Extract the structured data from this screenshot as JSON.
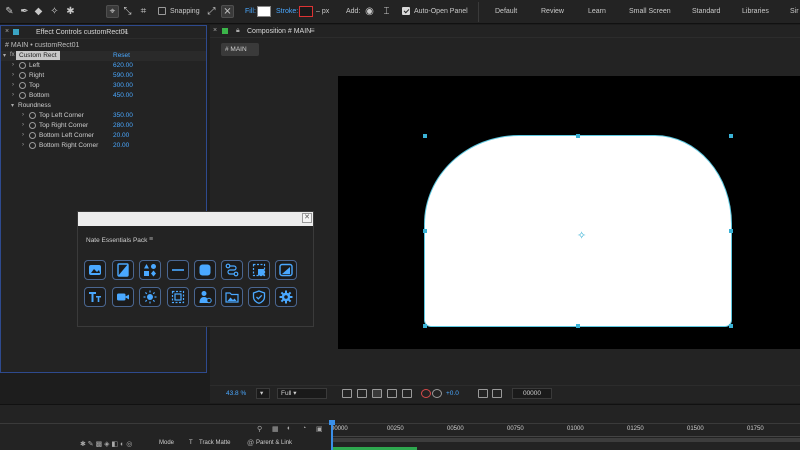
{
  "toolbar": {
    "snapping_label": "Snapping",
    "fill_label": "Fill:",
    "stroke_label": "Stroke:",
    "stroke_unit": "– px",
    "add_label": "Add:",
    "auto_open_label": "Auto-Open Panel",
    "workspaces": [
      "Default",
      "Review",
      "Learn",
      "Small Screen",
      "Standard",
      "Libraries",
      "Sir"
    ]
  },
  "effect_controls": {
    "tab_title": "Effect Controls customRect01",
    "subtitle": "# MAIN • customRect01",
    "effect_name": "Custom Rect",
    "reset_label": "Reset",
    "properties": [
      {
        "name": "Left",
        "value": "620.00"
      },
      {
        "name": "Right",
        "value": "590.00"
      },
      {
        "name": "Top",
        "value": "300.00"
      },
      {
        "name": "Bottom",
        "value": "450.00"
      }
    ],
    "group_name": "Roundness",
    "roundness": [
      {
        "name": "Top Left Corner",
        "value": "350.00"
      },
      {
        "name": "Top Right Corner",
        "value": "280.00"
      },
      {
        "name": "Bottom Left Corner",
        "value": "20.00"
      },
      {
        "name": "Bottom Right Corner",
        "value": "20.00"
      }
    ]
  },
  "plugin": {
    "title": "Nate Essentials Pack",
    "close_glyph": "✕",
    "icons": [
      "image-frame-icon",
      "split-layout-icon",
      "shapes-icon",
      "line-icon",
      "rounded-square-icon",
      "path-connect-icon",
      "selection-crop-icon",
      "image-icon",
      "text-tool-icon",
      "video-camera-icon",
      "sun-icon",
      "dashed-frame-icon",
      "person-badge-icon",
      "landscape-image-icon",
      "shield-check-icon",
      "gear-icon"
    ]
  },
  "composition": {
    "tab_title": "Composition # MAIN",
    "subtab_label": "# MAIN",
    "zoom_value": "43.8",
    "zoom_unit": "%",
    "resolution": "Full",
    "exposure": "+0.0",
    "timecode": "00000"
  },
  "timeline": {
    "headers": [
      "Mode",
      "T",
      "Track Matte",
      "Parent & Link"
    ],
    "ruler_ticks": [
      "00000",
      "00250",
      "00500",
      "00750",
      "01000",
      "01250",
      "01500",
      "01750"
    ]
  },
  "colors": {
    "accent_blue": "#4aa8ff",
    "selection_cyan": "#3ab2d6",
    "panel_bg": "#232323",
    "viewer_bg": "#000000",
    "shape_fill": "#ffffff"
  }
}
